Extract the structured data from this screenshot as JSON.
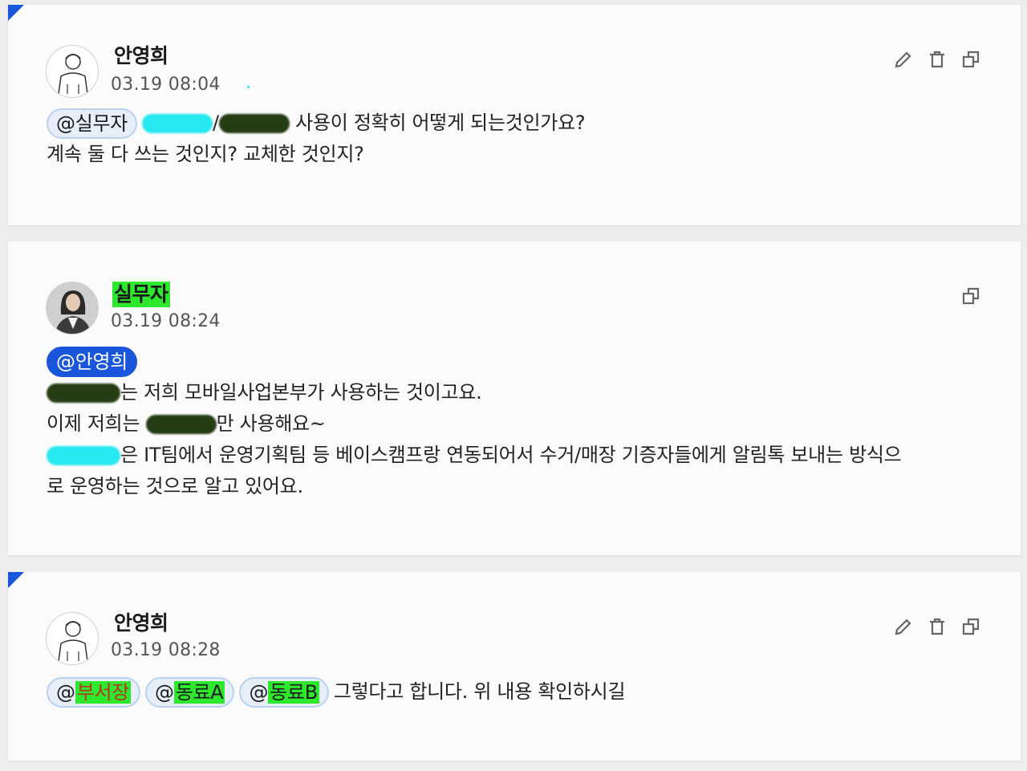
{
  "comments": [
    {
      "author": "안영희",
      "time": "03.19 08:04",
      "avatar": "person-illustration-icon",
      "mention": "@실무자",
      "line1_sep": "/",
      "line1_text": " 사용이 정확히 어떻게 되는것인가요?",
      "line2": "계속 둘 다 쓰는 것인지? 교체한 것인지?"
    },
    {
      "author": "실무자",
      "time": "03.19 08:24",
      "avatar": "woman-photo-icon",
      "mention": "@안영희",
      "line1_text": "는 저희 모바일사업본부가 사용하는 것이고요.",
      "line2_pre": "이제 저희는 ",
      "line2_post": "만 사용해요~",
      "line3_text": "은 IT팀에서 운영기획팀 등 베이스캠프랑 연동되어서 수거/매장 기증자들에게 알림톡 보내는 방식으",
      "line4": "로 운영하는 것으로 알고 있어요."
    },
    {
      "author": "안영희",
      "time": "03.19 08:28",
      "avatar": "person-illustration-icon",
      "mentions": [
        "부서장",
        "동료A",
        "동료B"
      ],
      "mention_prefix": "@",
      "text": "그렇다고 합니다. 위 내용 확인하시길"
    }
  ],
  "icons": {
    "edit": "pencil-icon",
    "delete": "trash-icon",
    "copy": "copy-icon"
  },
  "colors": {
    "accent": "#1a56db",
    "highlight": "#2ee82e",
    "mention_bg": "#e6eef9"
  }
}
